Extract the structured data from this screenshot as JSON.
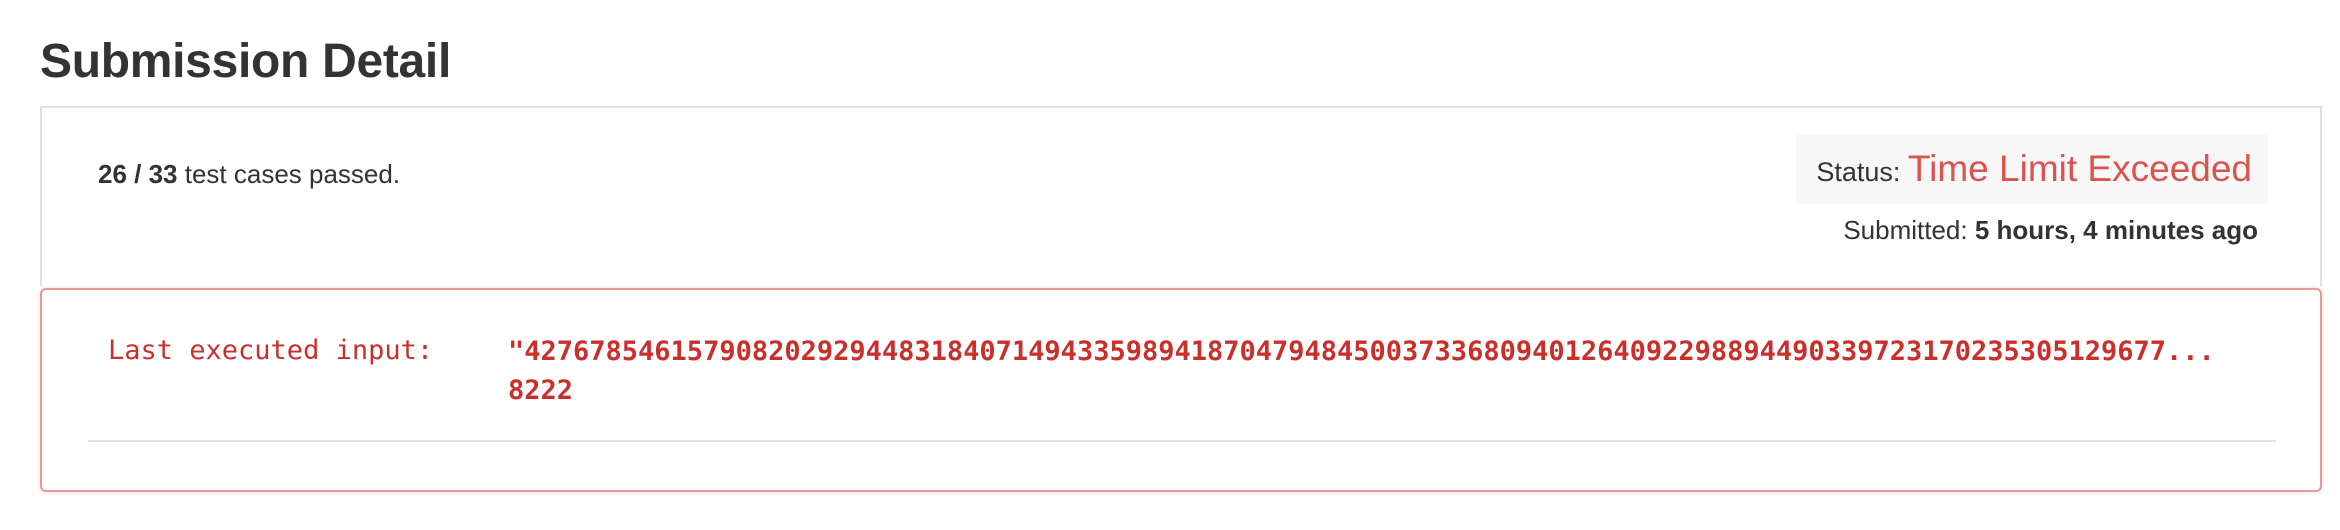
{
  "page": {
    "title": "Submission Detail"
  },
  "summary": {
    "passed": "26",
    "separator": " / ",
    "total": "33",
    "suffix": " test cases passed."
  },
  "status": {
    "label": "Status: ",
    "value": "Time Limit Exceeded",
    "value_color": "#d9534f"
  },
  "submitted": {
    "label": "Submitted: ",
    "value": "5 hours, 4 minutes ago"
  },
  "last_input": {
    "label": "Last executed input:",
    "line1": "\"42767854615790820292944831840714943359894187047948450037336809401264092298894490339723170235305129677...",
    "line2": "8222"
  }
}
